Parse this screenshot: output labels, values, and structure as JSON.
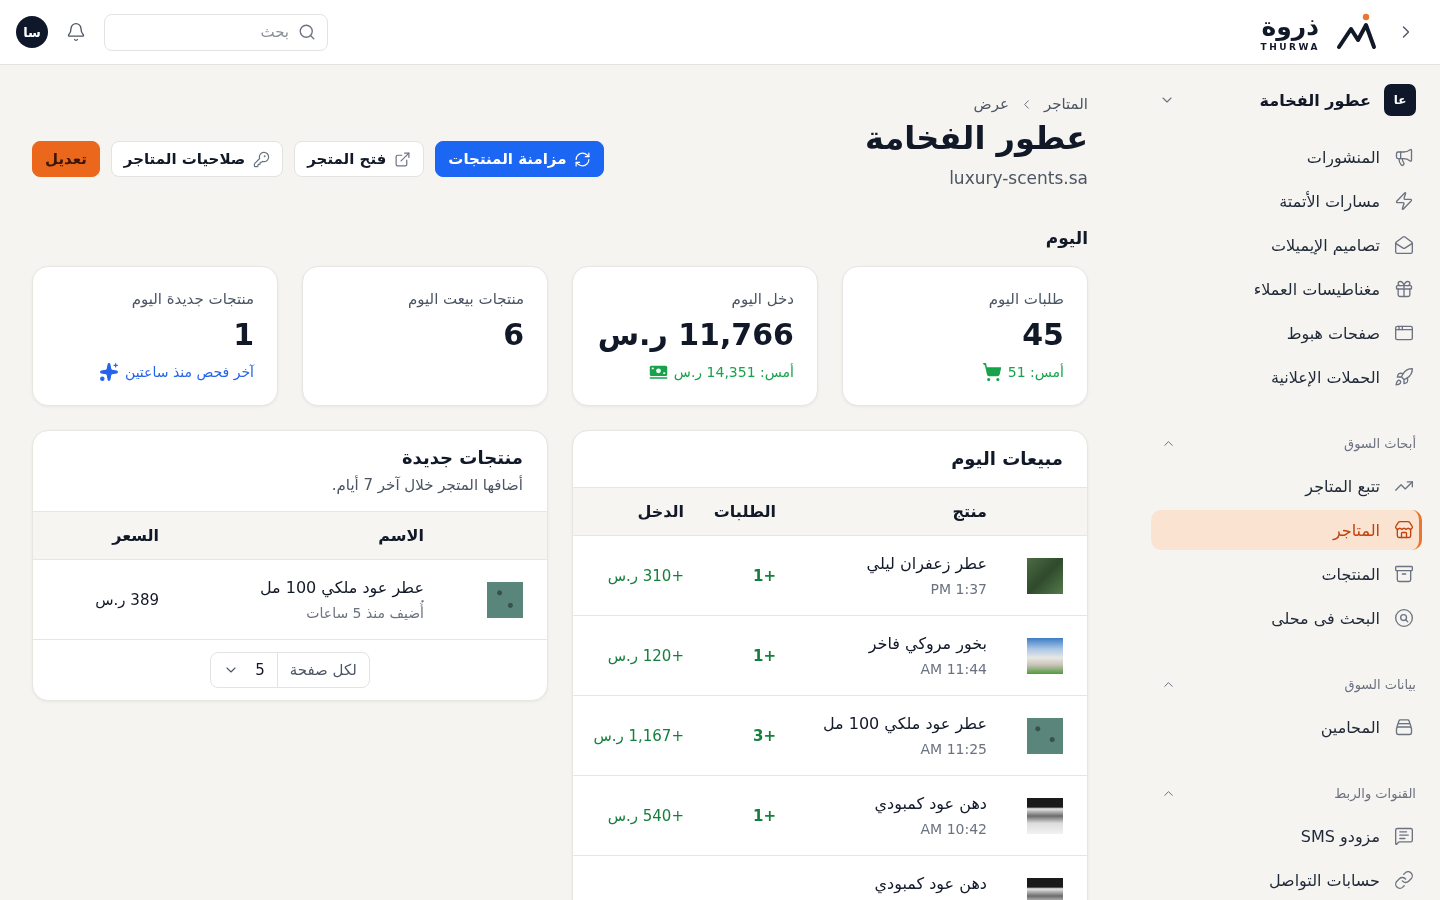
{
  "topbar": {
    "brand": {
      "name": "ذروة",
      "subtitle": "THURWA"
    },
    "search": {
      "placeholder": "بحث"
    },
    "avatar": "سا"
  },
  "sidebar": {
    "store": {
      "initials": "عا",
      "name": "عطور الفخامة"
    },
    "items": [
      {
        "label": "المنشورات",
        "selected": false
      },
      {
        "label": "مسارات الأتمتة",
        "selected": false
      },
      {
        "label": "تصاميم الإيميلات",
        "selected": false
      },
      {
        "label": "مغناطيسات العملاء",
        "selected": false
      },
      {
        "label": "صفحات هبوط",
        "selected": false
      },
      {
        "label": "الحملات الإعلانية",
        "selected": false
      }
    ],
    "groups": [
      {
        "title": "أبحاث السوق",
        "expanded": true,
        "items": [
          {
            "label": "تتبع المتاجر",
            "selected": false
          },
          {
            "label": "المتاجر",
            "selected": true
          },
          {
            "label": "المنتجات",
            "selected": false
          },
          {
            "label": "البحث فى محلى",
            "selected": false
          }
        ]
      },
      {
        "title": "بيانات السوق",
        "expanded": true,
        "items": [
          {
            "label": "المحامين",
            "selected": false
          }
        ]
      },
      {
        "title": "القنوات والربط",
        "expanded": true,
        "items": [
          {
            "label": "مزودو SMS",
            "selected": false
          },
          {
            "label": "حسابات التواصل",
            "selected": false
          }
        ]
      }
    ]
  },
  "page_header": {
    "breadcrumb": [
      "المتاجر",
      "عرض"
    ],
    "title": "عطور الفخامة",
    "url": "luxury-scents.sa",
    "actions": [
      {
        "label": "مزامنة المنتجات",
        "kind": "primary"
      },
      {
        "label": "فتح المتجر",
        "kind": "secondary"
      },
      {
        "label": "صلاحيات المتاجر",
        "kind": "secondary"
      },
      {
        "label": "تعديل",
        "kind": "accent"
      }
    ]
  },
  "section_title": "اليوم",
  "stats": [
    {
      "label": "طلبات اليوم",
      "value": "45",
      "note": {
        "text": "أمس: 51",
        "color": "#16a34a"
      }
    },
    {
      "label": "دخل اليوم",
      "value": "11,766 ر.س",
      "note": {
        "text": "أمس: 14,351 ر.س",
        "color": "#16a34a"
      }
    },
    {
      "label": "منتجات بيعت اليوم",
      "value": "6"
    },
    {
      "label": "منتجات جديدة اليوم",
      "value": "1",
      "note": {
        "text": "آخر فحص منذ ساعتين",
        "color": "#2563eb"
      }
    }
  ],
  "sales": {
    "title": "مبيعات اليوم",
    "columns": [
      "منتج",
      "الطلبات",
      "الدخل"
    ],
    "rows": [
      {
        "product": "عطر زعفران ليلي",
        "time": "PM 1:37",
        "orders": "+1",
        "revenue": "+310 ر.س"
      },
      {
        "product": "بخور مروكي فاخر",
        "time": "AM 11:44",
        "orders": "+1",
        "revenue": "+120 ر.س"
      },
      {
        "product": "عطر عود ملكي 100 مل",
        "time": "AM 11:25",
        "orders": "+3",
        "revenue": "+1,167 ر.س"
      },
      {
        "product": "دهن عود كمبودي",
        "time": "AM 10:42",
        "orders": "+1",
        "revenue": "+540 ر.س"
      },
      {
        "product": "دهن عود كمبودي"
      }
    ]
  },
  "new_products": {
    "title": "منتجات جديدة",
    "subtitle": "أضافها المتجر خلال آخر 7 أيام.",
    "columns": [
      "الاسم",
      "السعر"
    ],
    "rows": [
      {
        "name": "عطر عود ملكي 100 مل",
        "added": "أُضيف منذ 5 ساعات",
        "price": "389 ر.س"
      }
    ],
    "pagination": {
      "label": "لكل صفحة",
      "value": "5"
    }
  }
}
